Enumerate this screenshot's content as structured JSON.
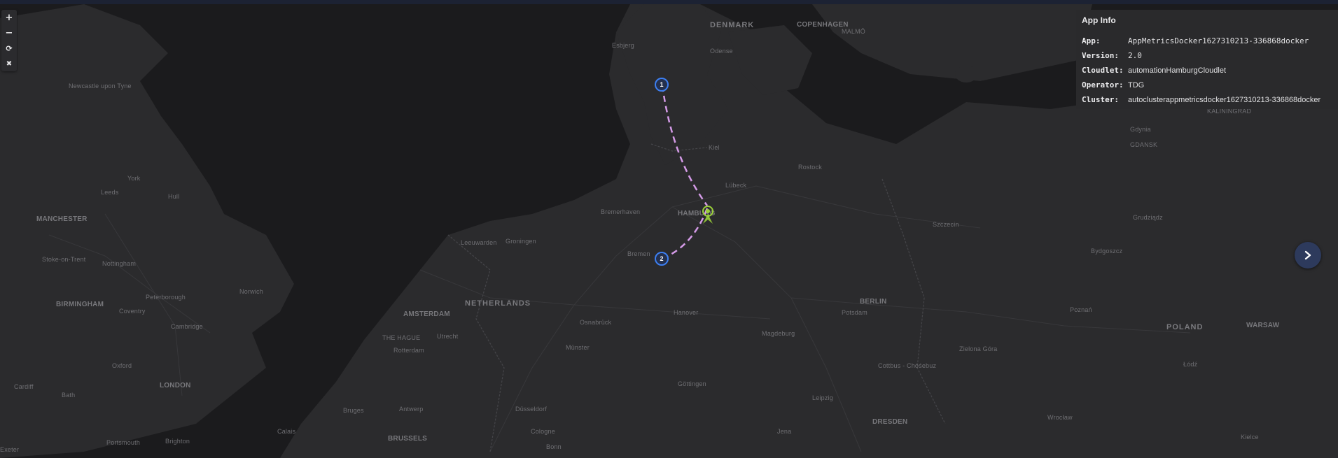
{
  "map_controls": {
    "zoom_in_icon": "+",
    "zoom_out_icon": "−",
    "reset_icon": "⟳",
    "close_icon": "✖"
  },
  "app_info": {
    "title": "App Info",
    "rows": [
      {
        "key": "App:",
        "value": "AppMetricsDocker1627310213-336868docker"
      },
      {
        "key": "Version:",
        "value": "2.0"
      },
      {
        "key": "Cloudlet:",
        "value": "automationHamburgCloudlet"
      },
      {
        "key": "Operator:",
        "value": "TDG"
      },
      {
        "key": "Cluster:",
        "value": "autoclusterappmetricsdocker1627310213-336868docker"
      }
    ]
  },
  "markers": [
    {
      "label": "1"
    },
    {
      "label": "2"
    }
  ],
  "map_labels": {
    "denmark": "DENMARK",
    "copenhagen": "COPENHAGEN",
    "malmo": "MALMÖ",
    "odense": "Odense",
    "esbjerg": "Esbjerg",
    "kiel": "Kiel",
    "rostock": "Rostock",
    "lubeck": "Lübeck",
    "hamburg": "HAMBURG",
    "bremerhaven": "Bremerhaven",
    "bremen": "Bremen",
    "groningen": "Groningen",
    "leeuwarden": "Leeuwarden",
    "netherlands": "NETHERLANDS",
    "amsterdam": "AMSTERDAM",
    "the_hague": "THE HAGUE",
    "utrecht": "Utrecht",
    "rotterdam": "Rotterdam",
    "osnabruck": "Osnabrück",
    "munster": "Münster",
    "hanover": "Hanover",
    "magdeburg": "Magdeburg",
    "berlin": "BERLIN",
    "potsdam": "Potsdam",
    "szczecin": "Szczecin",
    "gdansk": "GDANSK",
    "gdynia": "Gdynia",
    "kaliningrad": "KALININGRAD",
    "grudziadz": "Grudziądz",
    "bydgoszcz": "Bydgoszcz",
    "poznan": "Poznań",
    "poland": "POLAND",
    "warsaw": "WARSAW",
    "lodz": "Łódź",
    "zielona_gora": "Zielona Góra",
    "cottbus": "Cottbus - Chóśebuz",
    "gottingen": "Göttingen",
    "leipzig": "Leipzig",
    "dresden": "DRESDEN",
    "jena": "Jena",
    "wroclaw": "Wrocław",
    "kielce": "Kielce",
    "dusseldorf": "Düsseldorf",
    "cologne": "Cologne",
    "bonn": "Bonn",
    "antwerp": "Antwerp",
    "bruges": "Bruges",
    "brussels": "BRUSSELS",
    "newcastle": "Newcastle upon Tyne",
    "york": "York",
    "leeds": "Leeds",
    "hull": "Hull",
    "manchester": "MANCHESTER",
    "stoke": "Stoke-on-Trent",
    "nottingham": "Nottingham",
    "birmingham": "BIRMINGHAM",
    "peterborough": "Peterborough",
    "norwich": "Norwich",
    "coventry": "Coventry",
    "cambridge": "Cambridge",
    "oxford": "Oxford",
    "london": "LONDON",
    "cardiff": "Cardiff",
    "bath": "Bath",
    "portsmouth": "Portsmouth",
    "brighton": "Brighton",
    "exeter": "Exeter",
    "calais": "Calais"
  },
  "colors": {
    "route_line": "#d59be8",
    "marker_ring": "#3d7ff2",
    "cloudlet_marker": "#9bd13a",
    "panel_bg": "#2a2a2c",
    "next_button": "#2d3a5c"
  }
}
